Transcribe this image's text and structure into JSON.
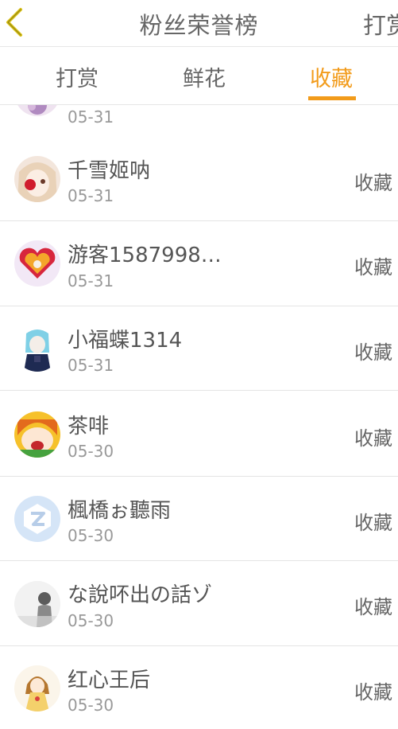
{
  "header": {
    "title": "粉丝荣誉榜",
    "right_label": "打赏",
    "back_icon": "chevron-left-icon",
    "back_color": "#d8c014"
  },
  "tabs": [
    {
      "label": "打赏",
      "active": false
    },
    {
      "label": "鲜花",
      "active": false
    },
    {
      "label": "收藏",
      "active": true
    }
  ],
  "accent_color": "#f29b1a",
  "rows": [
    {
      "name": "",
      "date": "05-31",
      "action": ""
    },
    {
      "name": "千雪姬呐",
      "date": "05-31",
      "action": "收藏"
    },
    {
      "name": "游客1587998…",
      "date": "05-31",
      "action": "收藏"
    },
    {
      "name": "小福蝶1314",
      "date": "05-31",
      "action": "收藏"
    },
    {
      "name": "茶啡",
      "date": "05-30",
      "action": "收藏"
    },
    {
      "name": "楓橋ぉ聽雨",
      "date": "05-30",
      "action": "收藏"
    },
    {
      "name": "な說吥出の話ゾ",
      "date": "05-30",
      "action": "收藏"
    },
    {
      "name": "红心王后",
      "date": "05-30",
      "action": "收藏"
    }
  ]
}
